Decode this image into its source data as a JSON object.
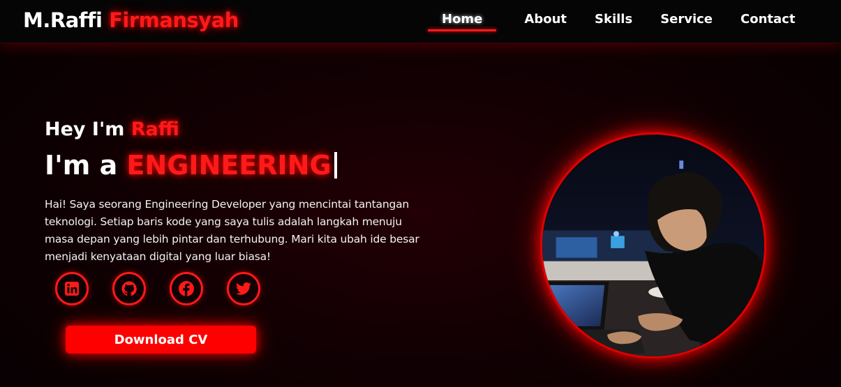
{
  "brand": {
    "first": "M.Raffi",
    "accent": "Firmansyah"
  },
  "nav": {
    "items": [
      {
        "label": "Home",
        "active": true
      },
      {
        "label": "About",
        "active": false
      },
      {
        "label": "Skills",
        "active": false
      },
      {
        "label": "Service",
        "active": false
      },
      {
        "label": "Contact",
        "active": false
      }
    ]
  },
  "hero": {
    "greeting_prefix": "Hey I'm",
    "greeting_name": "Raffi",
    "role_prefix": "I'm a",
    "role_typed": "ENGINEERING",
    "description": "Hai! Saya seorang Engineering Developer yang mencintai tantangan teknologi. Setiap baris kode yang saya tulis adalah langkah menuju masa depan yang lebih pintar dan terhubung. Mari kita ubah ide besar menjadi kenyataan digital yang luar biasa!",
    "socials": [
      {
        "icon": "linkedin-icon"
      },
      {
        "icon": "github-icon"
      },
      {
        "icon": "facebook-icon"
      },
      {
        "icon": "twitter-icon"
      }
    ],
    "cta_label": "Download CV"
  },
  "colors": {
    "accent": "#ff1a1a",
    "background": "#0a0002",
    "navbar": "#050505"
  }
}
